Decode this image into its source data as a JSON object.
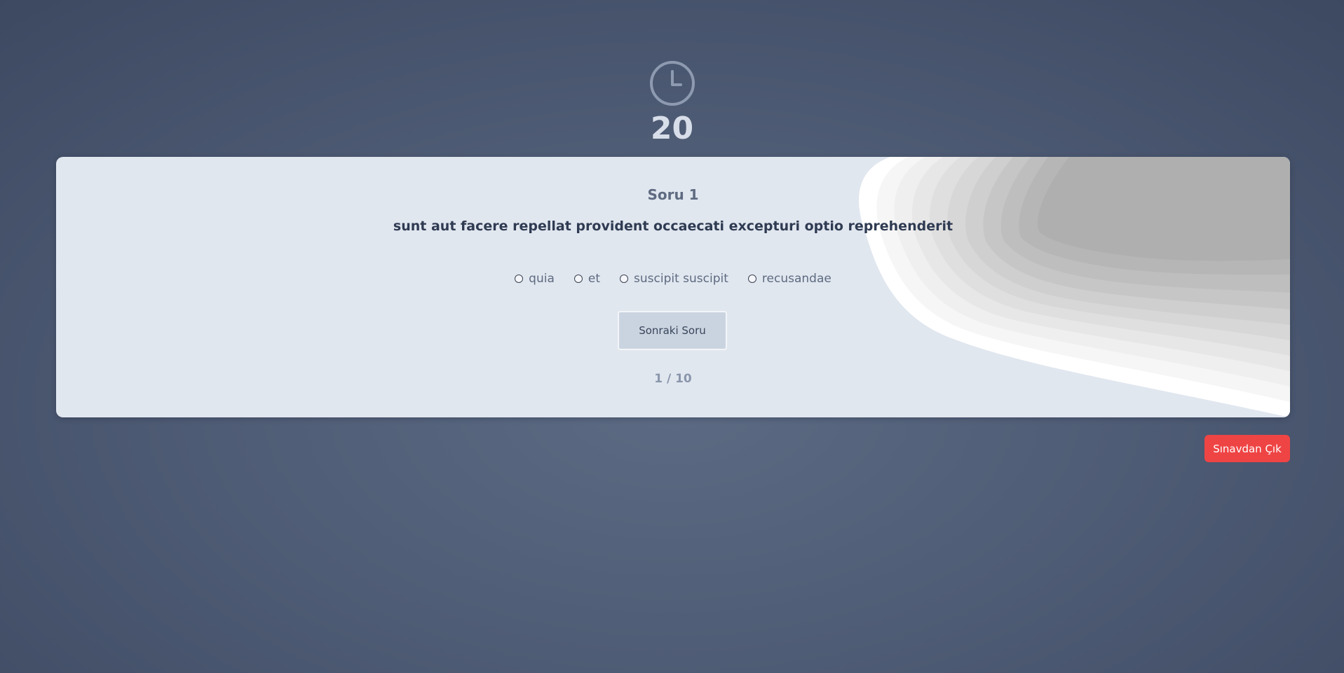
{
  "timer": {
    "icon": "clock-icon",
    "value": "20"
  },
  "quiz": {
    "question_label": "Soru 1",
    "question_text": "sunt aut facere repellat provident occaecati excepturi optio reprehenderit",
    "options": [
      {
        "label": "quia",
        "selected": false
      },
      {
        "label": "et",
        "selected": false
      },
      {
        "label": "suscipit suscipit",
        "selected": false
      },
      {
        "label": "recusandae",
        "selected": false
      }
    ],
    "next_button_label": "Sonraki Soru",
    "progress_text": "1 / 10"
  },
  "exit_button_label": "Sınavdan Çık",
  "colors": {
    "background": "#4f5c75",
    "card": "#e1e7ef",
    "exit_button": "#ef4444",
    "timer_text": "#d7dee9"
  }
}
